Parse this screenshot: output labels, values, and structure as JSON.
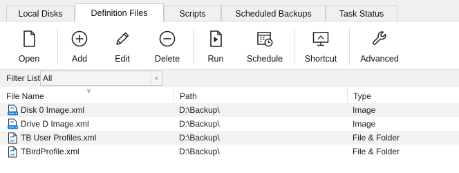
{
  "tabs": [
    {
      "label": "Local Disks",
      "active": false
    },
    {
      "label": "Definition Files",
      "active": true
    },
    {
      "label": "Scripts",
      "active": false
    },
    {
      "label": "Scheduled Backups",
      "active": false
    },
    {
      "label": "Task Status",
      "active": false
    }
  ],
  "toolbar": {
    "open": {
      "label": "Open",
      "icon": "file-icon"
    },
    "add": {
      "label": "Add",
      "icon": "plus-circle-icon"
    },
    "edit": {
      "label": "Edit",
      "icon": "pencil-icon"
    },
    "delete": {
      "label": "Delete",
      "icon": "minus-circle-icon"
    },
    "run": {
      "label": "Run",
      "icon": "run-file-icon"
    },
    "schedule": {
      "label": "Schedule",
      "icon": "calendar-clock-icon"
    },
    "shortcut": {
      "label": "Shortcut",
      "icon": "monitor-icon"
    },
    "advanced": {
      "label": "Advanced",
      "icon": "wrench-icon"
    }
  },
  "filter": {
    "label": "Filter List",
    "value": "All"
  },
  "table": {
    "columns": [
      "File Name",
      "Path",
      "Type"
    ],
    "rows": [
      {
        "name": "Disk 0 Image.xml",
        "path": "D:\\Backup\\",
        "type": "Image",
        "icon": "disk-image-file-icon"
      },
      {
        "name": "Drive D Image.xml",
        "path": "D:\\Backup\\",
        "type": "Image",
        "icon": "disk-image-file-icon"
      },
      {
        "name": "TB User Profiles.xml",
        "path": "D:\\Backup\\",
        "type": "File & Folder",
        "icon": "file-folder-file-icon"
      },
      {
        "name": "TBirdProfile.xml",
        "path": "D:\\Backup\\",
        "type": "File & Folder",
        "icon": "file-folder-file-icon"
      }
    ]
  },
  "colors": {
    "icon_blue": "#1e7fd6",
    "icon_dark": "#2a2a2a",
    "row_alt": "#f2f2f2"
  }
}
